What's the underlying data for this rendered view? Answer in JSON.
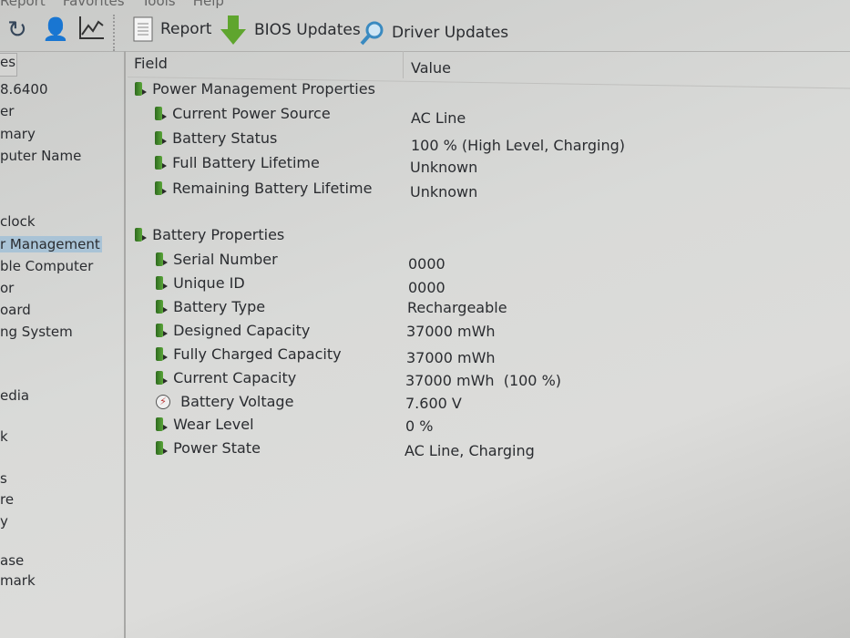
{
  "menu": {
    "items": [
      "Report",
      "Favorites",
      "Tools",
      "Help"
    ]
  },
  "toolbar": {
    "report_label": "Report",
    "bios_label": "BIOS Updates",
    "driver_label": "Driver Updates"
  },
  "sidebar": {
    "tab": "es",
    "items": [
      {
        "label": "8.6400"
      },
      {
        "label": "er"
      },
      {
        "label": "mary"
      },
      {
        "label": "puter Name"
      },
      {
        "label": "clock"
      },
      {
        "label": "r Management",
        "selected": true
      },
      {
        "label": "ble Computer"
      },
      {
        "label": "or"
      },
      {
        "label": "oard"
      },
      {
        "label": "ng System"
      },
      {
        "label": "edia"
      },
      {
        "label": "k"
      },
      {
        "label": "s"
      },
      {
        "label": "re"
      },
      {
        "label": "y"
      },
      {
        "label": "ase"
      },
      {
        "label": "mark"
      }
    ]
  },
  "table": {
    "col_field": "Field",
    "col_value": "Value",
    "groups": [
      {
        "title": "Power Management Properties",
        "rows": [
          {
            "field": "Current Power Source",
            "value": "AC Line",
            "icon": "battery"
          },
          {
            "field": "Battery Status",
            "value": "100 % (High Level, Charging)",
            "icon": "battery"
          },
          {
            "field": "Full Battery Lifetime",
            "value": "Unknown",
            "icon": "battery"
          },
          {
            "field": "Remaining Battery Lifetime",
            "value": "Unknown",
            "icon": "battery"
          }
        ]
      },
      {
        "title": "Battery Properties",
        "rows": [
          {
            "field": "Serial Number",
            "value": "0000",
            "icon": "battery"
          },
          {
            "field": "Unique ID",
            "value": "0000",
            "icon": "battery"
          },
          {
            "field": "Battery Type",
            "value": "Rechargeable",
            "icon": "battery"
          },
          {
            "field": "Designed Capacity",
            "value": "37000 mWh",
            "icon": "battery"
          },
          {
            "field": "Fully Charged Capacity",
            "value": "37000 mWh",
            "icon": "battery"
          },
          {
            "field": "Current Capacity",
            "value": "37000 mWh  (100 %)",
            "icon": "battery"
          },
          {
            "field": "Battery Voltage",
            "value": "7.600 V",
            "icon": "voltage"
          },
          {
            "field": "Wear Level",
            "value": "0 %",
            "icon": "battery"
          },
          {
            "field": "Power State",
            "value": "AC Line, Charging",
            "icon": "battery"
          }
        ]
      }
    ]
  }
}
